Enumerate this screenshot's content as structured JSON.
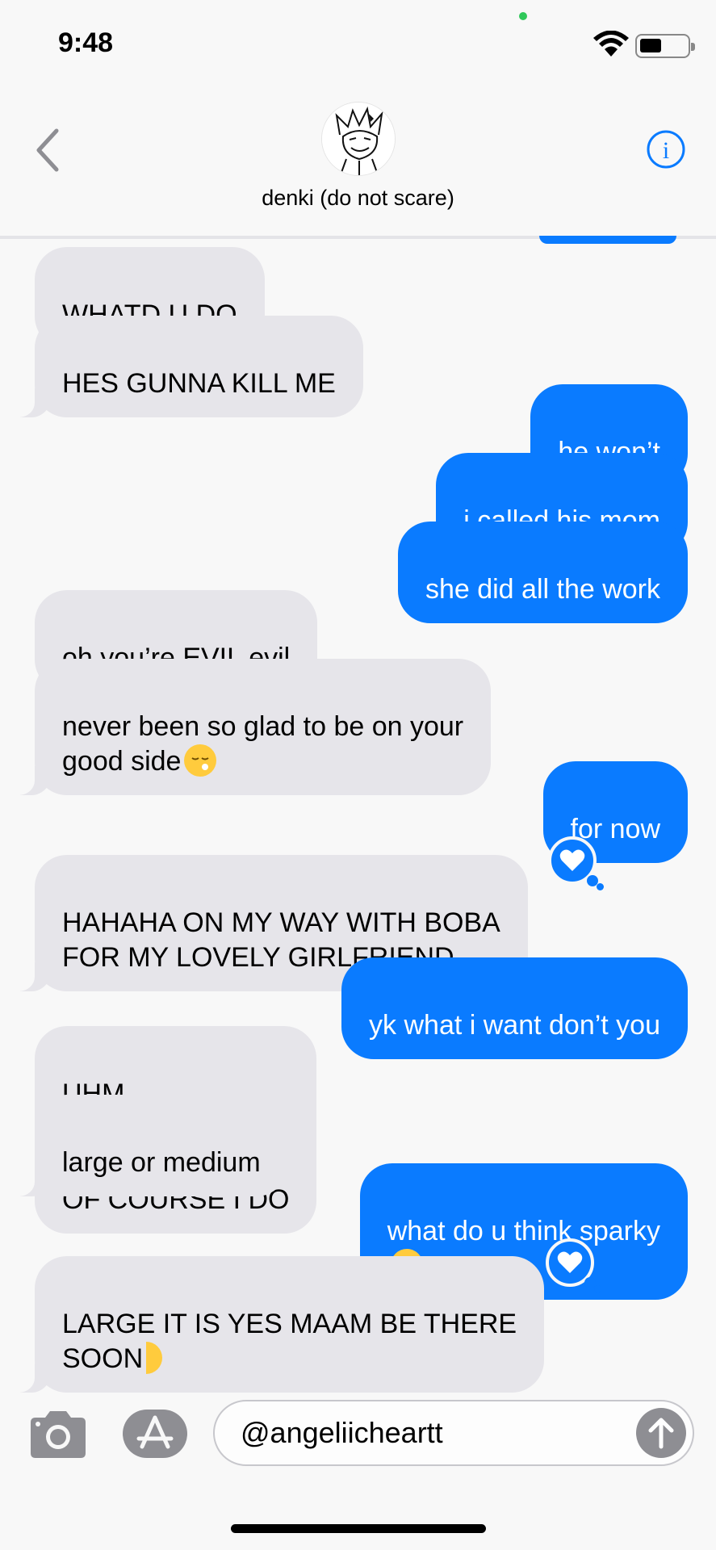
{
  "status": {
    "time": "9:48",
    "battery_level": 0.45
  },
  "header": {
    "back_icon": "chevron-left-icon",
    "contact_name": "denki (do not scare)",
    "info_icon": "info-icon"
  },
  "messages": [
    {
      "dir": "in",
      "text": "WHATD U DO"
    },
    {
      "dir": "in",
      "text": "HES GUNNA KILL ME"
    },
    {
      "dir": "out",
      "text": "he won’t"
    },
    {
      "dir": "out",
      "text": "i called his mom"
    },
    {
      "dir": "out",
      "text": "she did all the work"
    },
    {
      "dir": "in",
      "text": "oh you’re EVIL evil"
    },
    {
      "dir": "in",
      "text": "never been so glad to be on your\ngood side"
    },
    {
      "dir": "out",
      "text": "for now"
    },
    {
      "dir": "in",
      "text": "HAHAHA ON MY WAY WITH BOBA\nFOR MY LOVELY GIRLFRIEND",
      "tapback": "heart"
    },
    {
      "dir": "out",
      "text": "yk what i want don’t you"
    },
    {
      "dir": "in",
      "text_a": "UHM",
      "text_b": "OF COURSE I DO"
    },
    {
      "dir": "in",
      "text": "large or medium"
    },
    {
      "dir": "out",
      "text": "what do u think sparky"
    },
    {
      "dir": "in",
      "text": "LARGE IT IS YES MAAM BE THERE\nSOON",
      "tapback": "heart"
    }
  ],
  "composer": {
    "camera_icon": "camera-icon",
    "apps_icon": "app-store-icon",
    "input_value": "@angeliicheartt",
    "send_icon": "send-arrow-icon"
  },
  "colors": {
    "outgoing": "#0a7bff",
    "incoming": "#e6e5ea",
    "background": "#f8f8f8"
  }
}
